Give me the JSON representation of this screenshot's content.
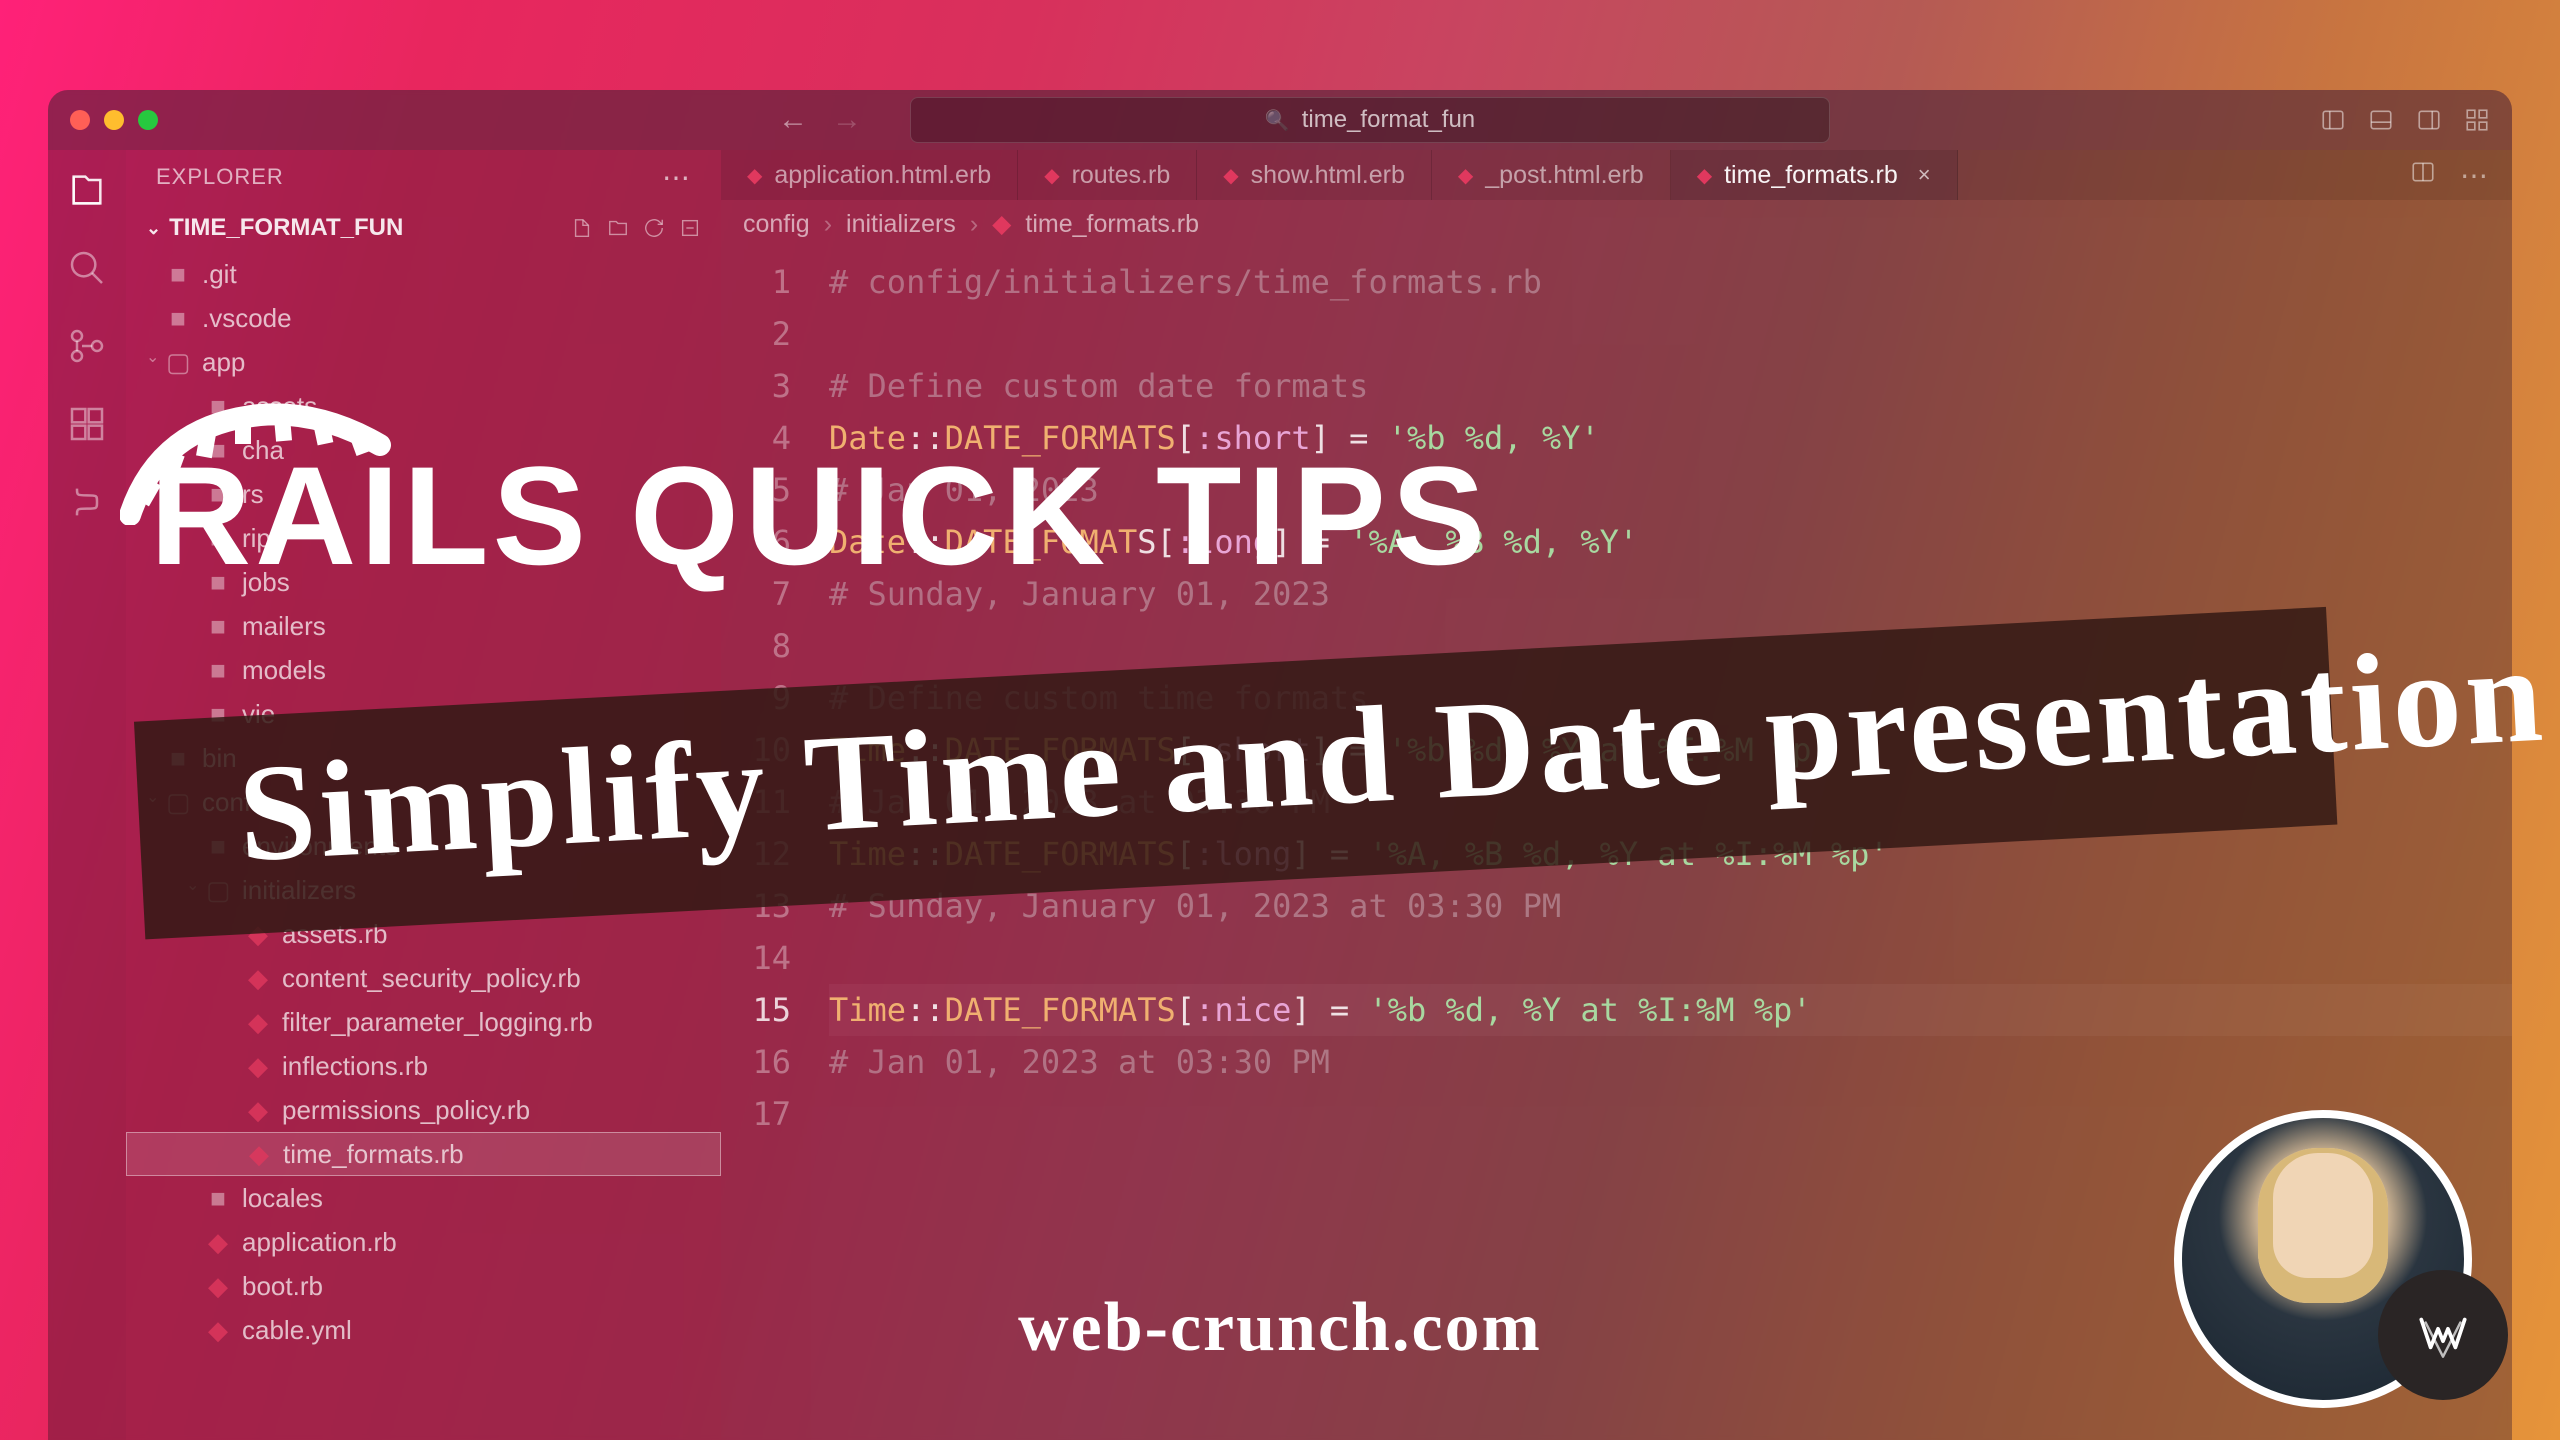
{
  "window": {
    "search_text": "time_format_fun"
  },
  "sidebar": {
    "title": "EXPLORER",
    "root_folder": "TIME_FORMAT_FUN",
    "items": [
      {
        "label": ".git",
        "type": "folder-closed",
        "indent": 40
      },
      {
        "label": ".vscode",
        "type": "folder-closed",
        "indent": 40
      },
      {
        "label": "app",
        "type": "folder-open",
        "indent": 40
      },
      {
        "label": "assets",
        "type": "folder-closed",
        "indent": 80
      },
      {
        "label": "cha",
        "type": "folder-closed",
        "indent": 80
      },
      {
        "label": "rs",
        "type": "folder-closed",
        "indent": 80
      },
      {
        "label": "ript",
        "type": "folder-closed",
        "indent": 80
      },
      {
        "label": "jobs",
        "type": "folder-closed",
        "indent": 80
      },
      {
        "label": "mailers",
        "type": "folder-closed",
        "indent": 80
      },
      {
        "label": "models",
        "type": "folder-closed",
        "indent": 80
      },
      {
        "label": "vie",
        "type": "folder-closed",
        "indent": 80
      },
      {
        "label": "bin",
        "type": "folder-closed",
        "indent": 40
      },
      {
        "label": "config",
        "type": "folder-open",
        "indent": 40
      },
      {
        "label": "environments",
        "type": "folder-closed",
        "indent": 80
      },
      {
        "label": "initializers",
        "type": "folder-open",
        "indent": 80
      },
      {
        "label": "assets.rb",
        "type": "ruby",
        "indent": 120
      },
      {
        "label": "content_security_policy.rb",
        "type": "ruby",
        "indent": 120
      },
      {
        "label": "filter_parameter_logging.rb",
        "type": "ruby",
        "indent": 120
      },
      {
        "label": "inflections.rb",
        "type": "ruby",
        "indent": 120
      },
      {
        "label": "permissions_policy.rb",
        "type": "ruby",
        "indent": 120
      },
      {
        "label": "time_formats.rb",
        "type": "ruby",
        "indent": 120,
        "selected": true
      },
      {
        "label": "locales",
        "type": "folder-closed",
        "indent": 80
      },
      {
        "label": "application.rb",
        "type": "ruby",
        "indent": 80
      },
      {
        "label": "boot.rb",
        "type": "ruby",
        "indent": 80
      },
      {
        "label": "cable.yml",
        "type": "ruby",
        "indent": 80
      }
    ]
  },
  "tabs": [
    {
      "label": "application.html.erb",
      "active": false
    },
    {
      "label": "routes.rb",
      "active": false
    },
    {
      "label": "show.html.erb",
      "active": false
    },
    {
      "label": "_post.html.erb",
      "active": false
    },
    {
      "label": "time_formats.rb",
      "active": true
    }
  ],
  "breadcrumbs": {
    "seg0": "config",
    "seg1": "initializers",
    "seg2": "time_formats.rb"
  },
  "code": {
    "lines": [
      {
        "n": 1,
        "segs": [
          {
            "t": "# config/initializers/time_formats.rb",
            "c": "comment"
          }
        ]
      },
      {
        "n": 2,
        "segs": []
      },
      {
        "n": 3,
        "segs": [
          {
            "t": "# Define custom date formats",
            "c": "comment"
          }
        ]
      },
      {
        "n": 4,
        "segs": [
          {
            "t": "Date",
            "c": "const"
          },
          {
            "t": "::",
            "c": "op"
          },
          {
            "t": "DATE_FORMATS",
            "c": "const"
          },
          {
            "t": "[",
            "c": "op"
          },
          {
            "t": ":short",
            "c": "sym"
          },
          {
            "t": "] = ",
            "c": "op"
          },
          {
            "t": "'%b %d, %Y'",
            "c": "str"
          }
        ]
      },
      {
        "n": 5,
        "segs": [
          {
            "t": "# Jan 01, 2023",
            "c": "comment"
          }
        ]
      },
      {
        "n": 6,
        "segs": [
          {
            "t": "Date",
            "c": "const"
          },
          {
            "t": "::",
            "c": "op"
          },
          {
            "t": "DATE_FO",
            "c": "const"
          },
          {
            "t": "MAT",
            "c": "const"
          },
          {
            "t": "S[",
            "c": "op"
          },
          {
            "t": ":lo",
            "c": "sym"
          },
          {
            "t": "ng",
            "c": "sym"
          },
          {
            "t": "] = ",
            "c": "op"
          },
          {
            "t": "'%A, %B %d, %Y'",
            "c": "str"
          }
        ]
      },
      {
        "n": 7,
        "segs": [
          {
            "t": "# Sunday, January 01, 2023",
            "c": "comment"
          }
        ]
      },
      {
        "n": 8,
        "segs": []
      },
      {
        "n": 9,
        "segs": [
          {
            "t": "# Define custom time formats",
            "c": "comment"
          }
        ]
      },
      {
        "n": 10,
        "segs": [
          {
            "t": "Time",
            "c": "const"
          },
          {
            "t": "::",
            "c": "op"
          },
          {
            "t": "DATE_FORMATS",
            "c": "const"
          },
          {
            "t": "[",
            "c": "op"
          },
          {
            "t": ":short",
            "c": "sym"
          },
          {
            "t": "] = ",
            "c": "op"
          },
          {
            "t": "'%b %d, %Y at %I:%M %p'",
            "c": "str"
          }
        ]
      },
      {
        "n": 11,
        "segs": [
          {
            "t": "# Jan 01, 2023 at 03:30 PM",
            "c": "comment"
          }
        ]
      },
      {
        "n": 12,
        "segs": [
          {
            "t": "Time",
            "c": "const"
          },
          {
            "t": "::",
            "c": "op"
          },
          {
            "t": "DATE_FORMATS",
            "c": "const"
          },
          {
            "t": "[",
            "c": "op"
          },
          {
            "t": ":long",
            "c": "sym"
          },
          {
            "t": "] = ",
            "c": "op"
          },
          {
            "t": "'%A, %B %d, %Y at %I:%M %p'",
            "c": "str"
          }
        ]
      },
      {
        "n": 13,
        "segs": [
          {
            "t": "# Sunday, January 01, 2023 at 03:30 PM",
            "c": "comment"
          }
        ]
      },
      {
        "n": 14,
        "segs": []
      },
      {
        "n": 15,
        "hl": true,
        "segs": [
          {
            "t": "Time",
            "c": "const"
          },
          {
            "t": "::",
            "c": "op"
          },
          {
            "t": "DATE_FORMATS",
            "c": "const"
          },
          {
            "t": "[",
            "c": "op"
          },
          {
            "t": ":nice",
            "c": "sym"
          },
          {
            "t": "] = ",
            "c": "op"
          },
          {
            "t": "'%b %d, %Y at %I:%M %p'",
            "c": "str"
          }
        ]
      },
      {
        "n": 16,
        "segs": [
          {
            "t": "# Jan 01, 2023 at 03:30 PM",
            "c": "comment"
          }
        ]
      },
      {
        "n": 17,
        "segs": []
      }
    ]
  },
  "overlay": {
    "title_rails": "RAILS",
    "title_rest": "QUICK TIPS",
    "subtitle": "Simplify Time and Date presentation",
    "website": "web-crunch.com"
  }
}
